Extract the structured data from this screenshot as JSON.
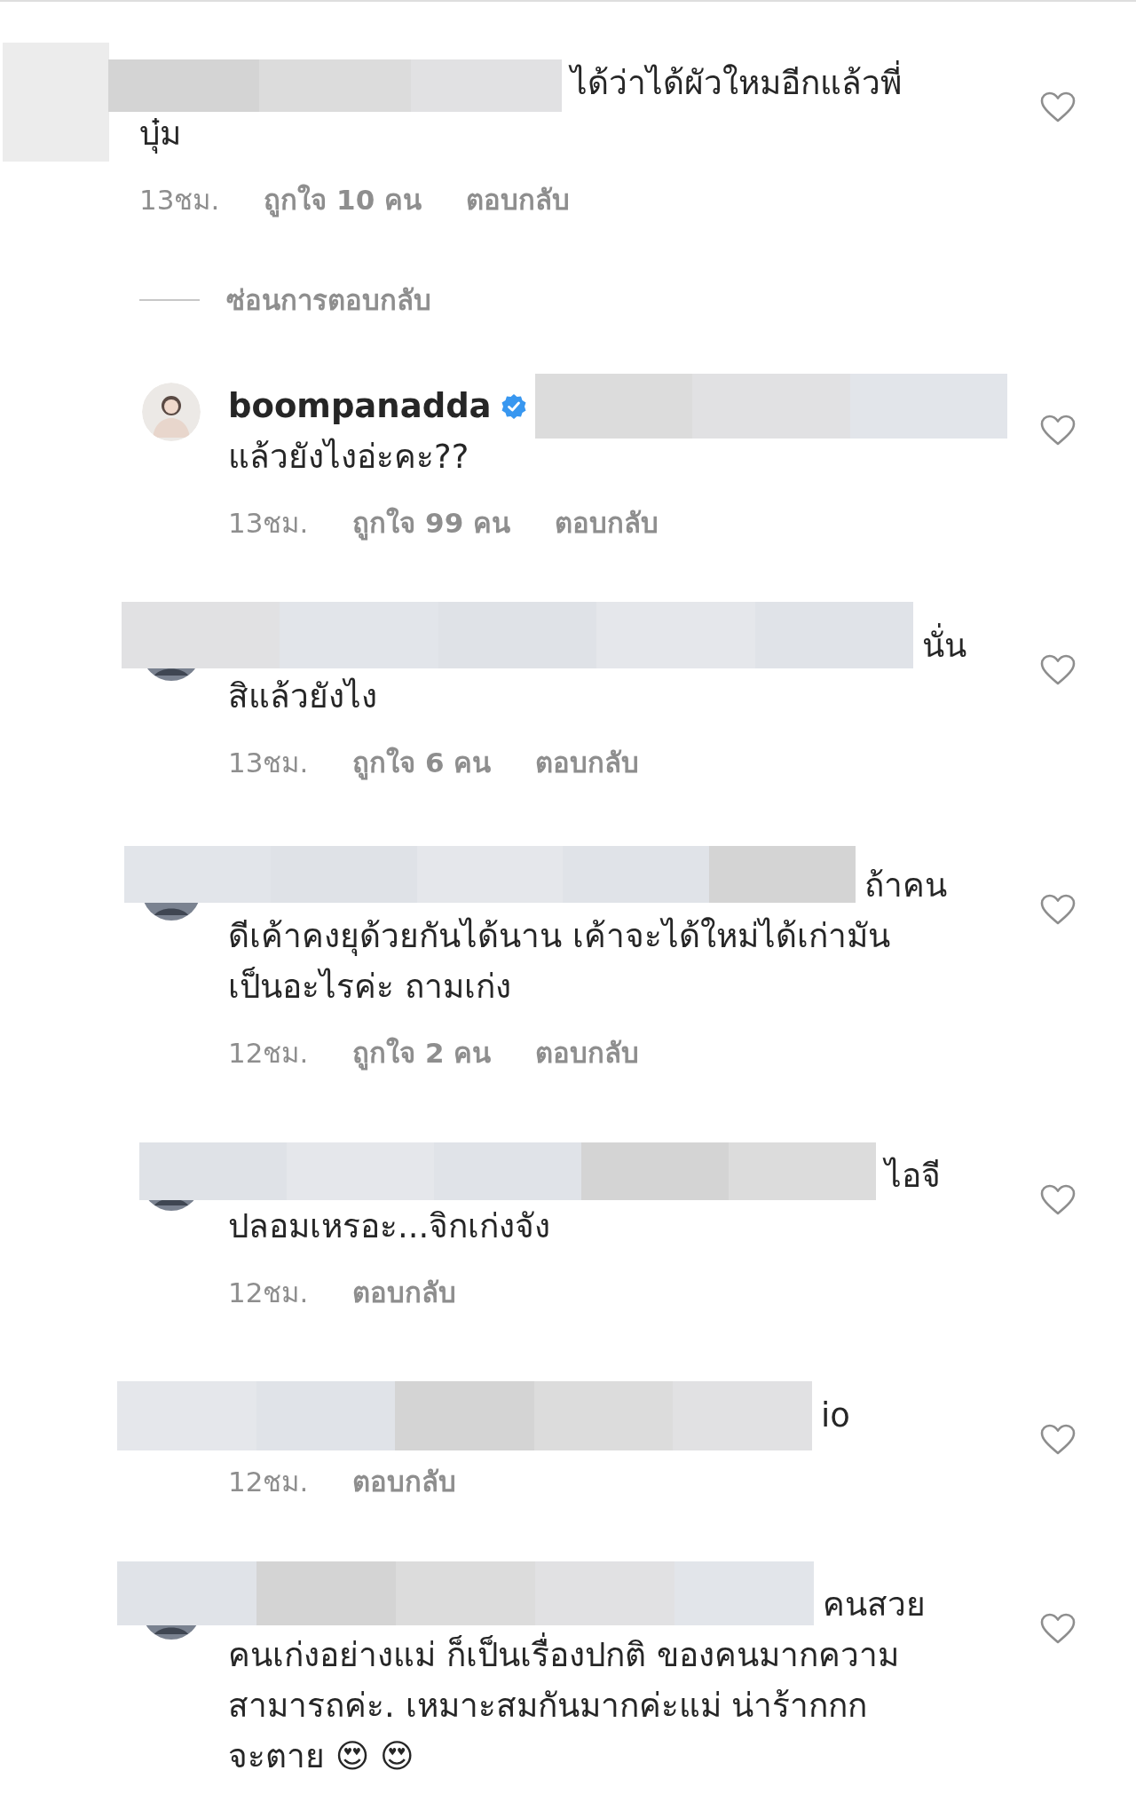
{
  "comments": [
    {
      "text_lines": [
        "ได้ว่าได้ผัวใหมอีกแล้วพี่",
        "บุ๋ม"
      ],
      "time": "13ชม.",
      "likes": "ถูกใจ 10 คน",
      "reply": "ตอบกลับ",
      "hide_replies": "ซ่อนการตอบกลับ",
      "replies": [
        {
          "username": "boompanadda",
          "verified": true,
          "text_lines": [
            "แล้วยังไงอ่ะคะ??"
          ],
          "time": "13ชม.",
          "likes": "ถูกใจ 99 คน",
          "reply": "ตอบกลับ"
        },
        {
          "text_lines": [
            "นั่น",
            "สิแล้วยังไง"
          ],
          "time": "13ชม.",
          "likes": "ถูกใจ 6 คน",
          "reply": "ตอบกลับ"
        },
        {
          "text_lines": [
            "ถ้าคน",
            "ดีเค้าคงยุด้วยกันได้นาน เค้าจะได้ใหม่ได้เก่ามัน",
            "เป็นอะไรค่ะ ถามเก่ง"
          ],
          "time": "12ชม.",
          "likes": "ถูกใจ 2 คน",
          "reply": "ตอบกลับ"
        },
        {
          "text_lines": [
            "ไอจี",
            "ปลอมเหรอะ...จิกเก่งจัง"
          ],
          "time": "12ชม.",
          "reply": "ตอบกลับ"
        },
        {
          "text_lines": [
            "io"
          ],
          "time": "12ชม.",
          "reply": "ตอบกลับ"
        },
        {
          "text_lines": [
            "คนสวย",
            "คนเก่งอย่างแม่ ก็เป็นเรื่องปกติ ของคนมากความ",
            "สามารถค่ะ.  เหมาะสมกันมากค่ะแม่ น่าร้ากกก",
            "จะตาย 😍 😍"
          ]
        }
      ]
    }
  ]
}
